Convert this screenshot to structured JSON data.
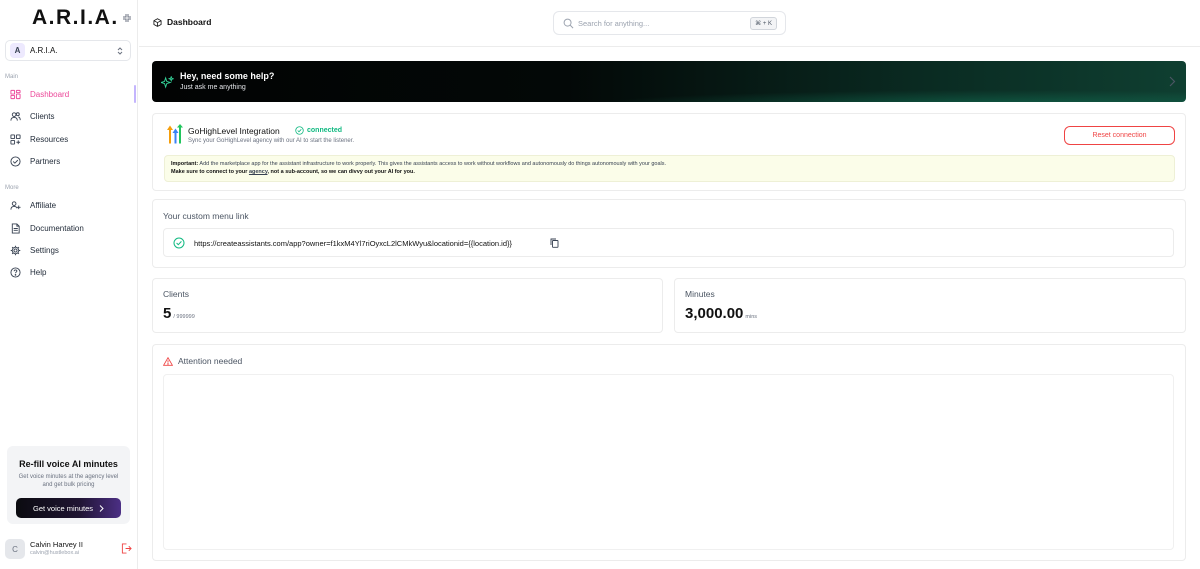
{
  "app": {
    "logo": "A.R.I.A."
  },
  "workspace": {
    "avatar_letter": "A",
    "name": "A.R.I.A."
  },
  "sidebar": {
    "main_label": "Main",
    "more_label": "More",
    "main_items": [
      {
        "label": "Dashboard",
        "icon": "dashboard-icon",
        "active": true
      },
      {
        "label": "Clients",
        "icon": "users-icon"
      },
      {
        "label": "Resources",
        "icon": "grid-plus-icon"
      },
      {
        "label": "Partners",
        "icon": "handshake-icon"
      }
    ],
    "more_items": [
      {
        "label": "Affiliate",
        "icon": "user-plus-icon"
      },
      {
        "label": "Documentation",
        "icon": "document-icon"
      },
      {
        "label": "Settings",
        "icon": "gear-icon"
      },
      {
        "label": "Help",
        "icon": "help-circle-icon"
      }
    ]
  },
  "promo": {
    "title": "Re-fill voice AI minutes",
    "text": "Get voice minutes at the agency level and get bulk pricing",
    "button": "Get voice minutes"
  },
  "user": {
    "avatar_letter": "C",
    "name": "Calvin Harvey II",
    "email": "calvin@hustlebox.ai"
  },
  "header": {
    "title": "Dashboard",
    "search_placeholder": "Search for anything...",
    "search_shortcut": "⌘ + K"
  },
  "banner": {
    "title": "Hey, need some help?",
    "subtitle": "Just ask me anything"
  },
  "integration": {
    "title": "GoHighLevel Integration",
    "status": "connected",
    "subtitle": "Sync your GoHighLevel agency with our AI to start the listener.",
    "reset_button": "Reset connection",
    "notice_bold": "Important:",
    "notice_text": " Add the marketplace app for the assistant infrastructure to work properly. This gives the assistants access to work without workflows and autonomously do things autonomously with your goals.",
    "notice_line2_a": "Make sure to connect to your ",
    "notice_line2_link": "agency",
    "notice_line2_b": ", not a sub-account, so we can divvy out your AI for you."
  },
  "menu_link": {
    "title": "Your custom menu link",
    "url": "https://createassistants.com/app?owner=f1kxM4Yl7riOyxcL2lCMkWyu&locationid={{location.id}}"
  },
  "stats": {
    "clients_label": "Clients",
    "clients_value": "5",
    "clients_unit": "/ 999999",
    "minutes_label": "Minutes",
    "minutes_value": "3,000.00",
    "minutes_unit": "mins"
  },
  "attention": {
    "title": "Attention needed"
  },
  "colors": {
    "accent_pink": "#ec4899",
    "success": "#10b981",
    "danger": "#ef4444"
  }
}
